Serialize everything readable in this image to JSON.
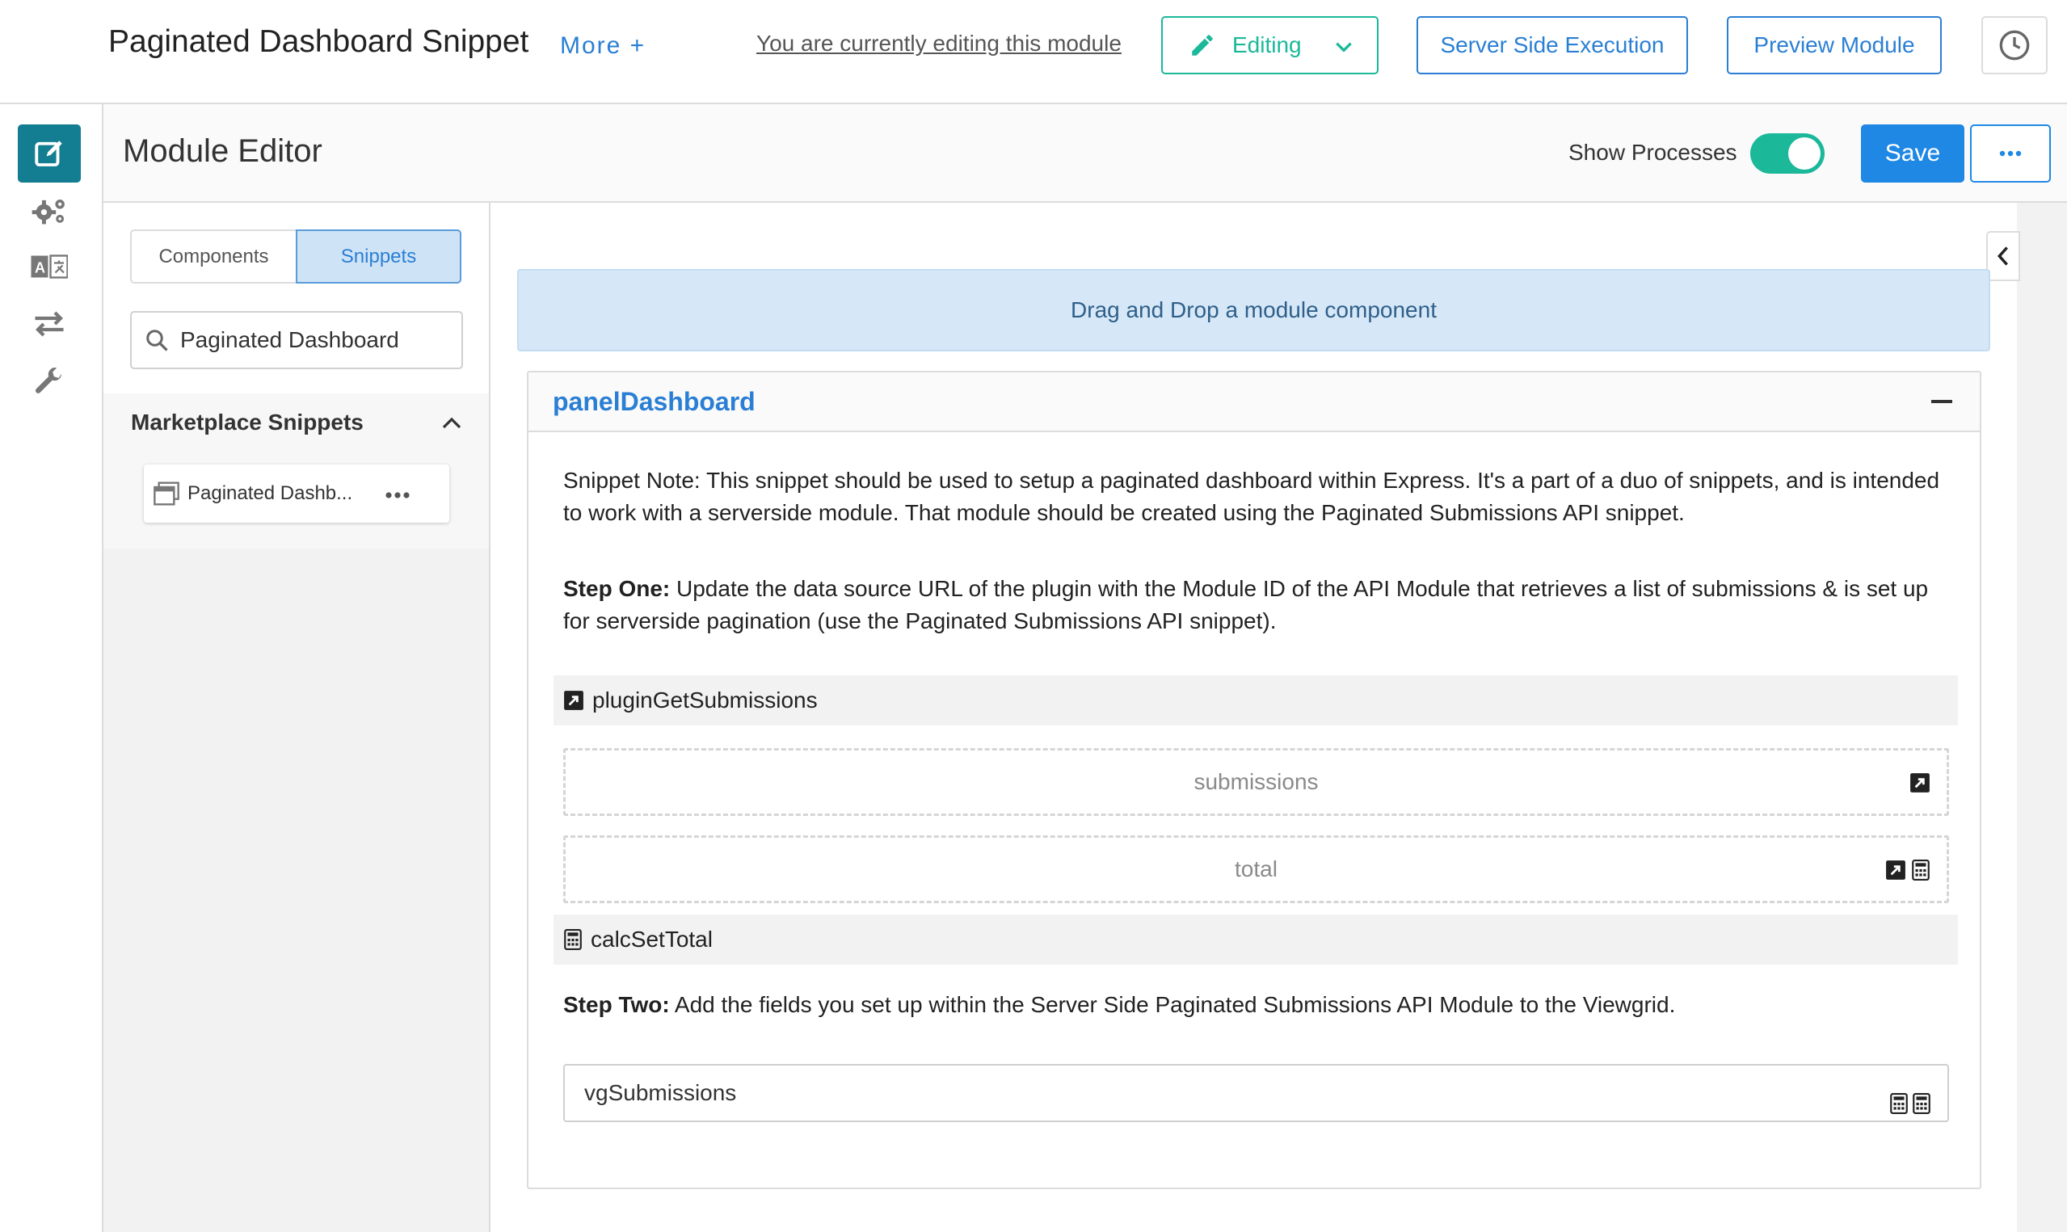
{
  "header": {
    "title": "Paginated Dashboard Snippet",
    "more_label": "More +",
    "editing_note": "You are currently editing this module",
    "editing_label": "Editing",
    "server_side_label": "Server Side Execution",
    "preview_label": "Preview Module"
  },
  "rail": {
    "items": [
      "edit-icon",
      "gears-icon",
      "translate-icon",
      "exchange-icon",
      "wrench-icon"
    ],
    "active_color": "#137d92"
  },
  "editor": {
    "title": "Module Editor",
    "show_processes_label": "Show Processes",
    "show_processes_on": true,
    "save_label": "Save"
  },
  "sidebar": {
    "tabs": [
      "Components",
      "Snippets"
    ],
    "active_tab": "Snippets",
    "search_value": "Paginated Dashboard",
    "section_title": "Marketplace Snippets",
    "snippet_item": "Paginated Dashb..."
  },
  "canvas": {
    "dropzone_text": "Drag and Drop a module component",
    "panel_title": "panelDashboard",
    "note_1": "Snippet Note: This snippet should be used to setup a paginated dashboard within Express. It's a part of a duo of snippets, and is intended to work with a serverside module. That module should be created using the Paginated Submissions API snippet.",
    "step_one_label": "Step One:",
    "step_one_text": " Update the data source URL of the plugin with the Module ID of the API Module that retrieves a list of submissions & is set up for serverside pagination (use the Paginated Submissions API snippet).",
    "plugin_name": "pluginGetSubmissions",
    "field_submissions": "submissions",
    "field_total": "total",
    "calc_name": "calcSetTotal",
    "step_two_label": "Step Two:",
    "step_two_text": " Add the fields you set up within the Server Side Paginated Submissions API Module to the Viewgrid.",
    "viewgrid_name": "vgSubmissions"
  },
  "colors": {
    "accent_blue": "#2a7fd4",
    "teal": "#1bb89a",
    "save_blue": "#1f88e5",
    "dropzone_bg": "#d6e8f7"
  }
}
